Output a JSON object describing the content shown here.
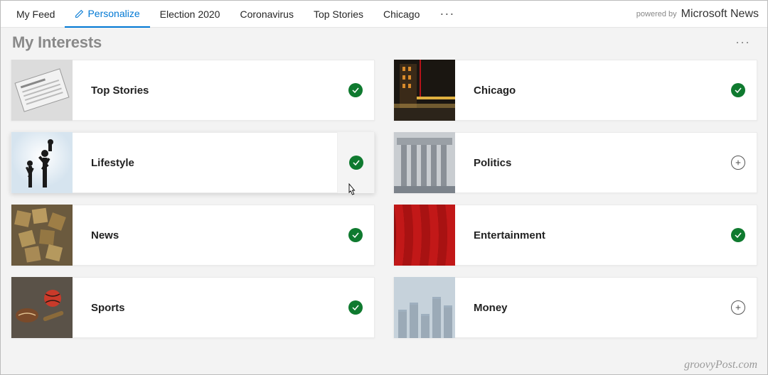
{
  "nav": {
    "items": [
      {
        "label": "My Feed",
        "active": false
      },
      {
        "label": "Personalize",
        "active": true,
        "icon": "pencil"
      },
      {
        "label": "Election 2020",
        "active": false
      },
      {
        "label": "Coronavirus",
        "active": false
      },
      {
        "label": "Top Stories",
        "active": false
      },
      {
        "label": "Chicago",
        "active": false
      }
    ],
    "powered_label": "powered by",
    "powered_brand": "Microsoft News"
  },
  "page": {
    "title": "My Interests"
  },
  "interests": [
    {
      "label": "Top Stories",
      "selected": true,
      "thumb": "newspaper"
    },
    {
      "label": "Chicago",
      "selected": true,
      "thumb": "chicago"
    },
    {
      "label": "Lifestyle",
      "selected": true,
      "thumb": "lifestyle",
      "hovered": true
    },
    {
      "label": "Politics",
      "selected": false,
      "thumb": "politics"
    },
    {
      "label": "News",
      "selected": true,
      "thumb": "news"
    },
    {
      "label": "Entertainment",
      "selected": true,
      "thumb": "entertainment"
    },
    {
      "label": "Sports",
      "selected": true,
      "thumb": "sports"
    },
    {
      "label": "Money",
      "selected": false,
      "thumb": "money"
    }
  ],
  "watermark": "groovyPost.com"
}
